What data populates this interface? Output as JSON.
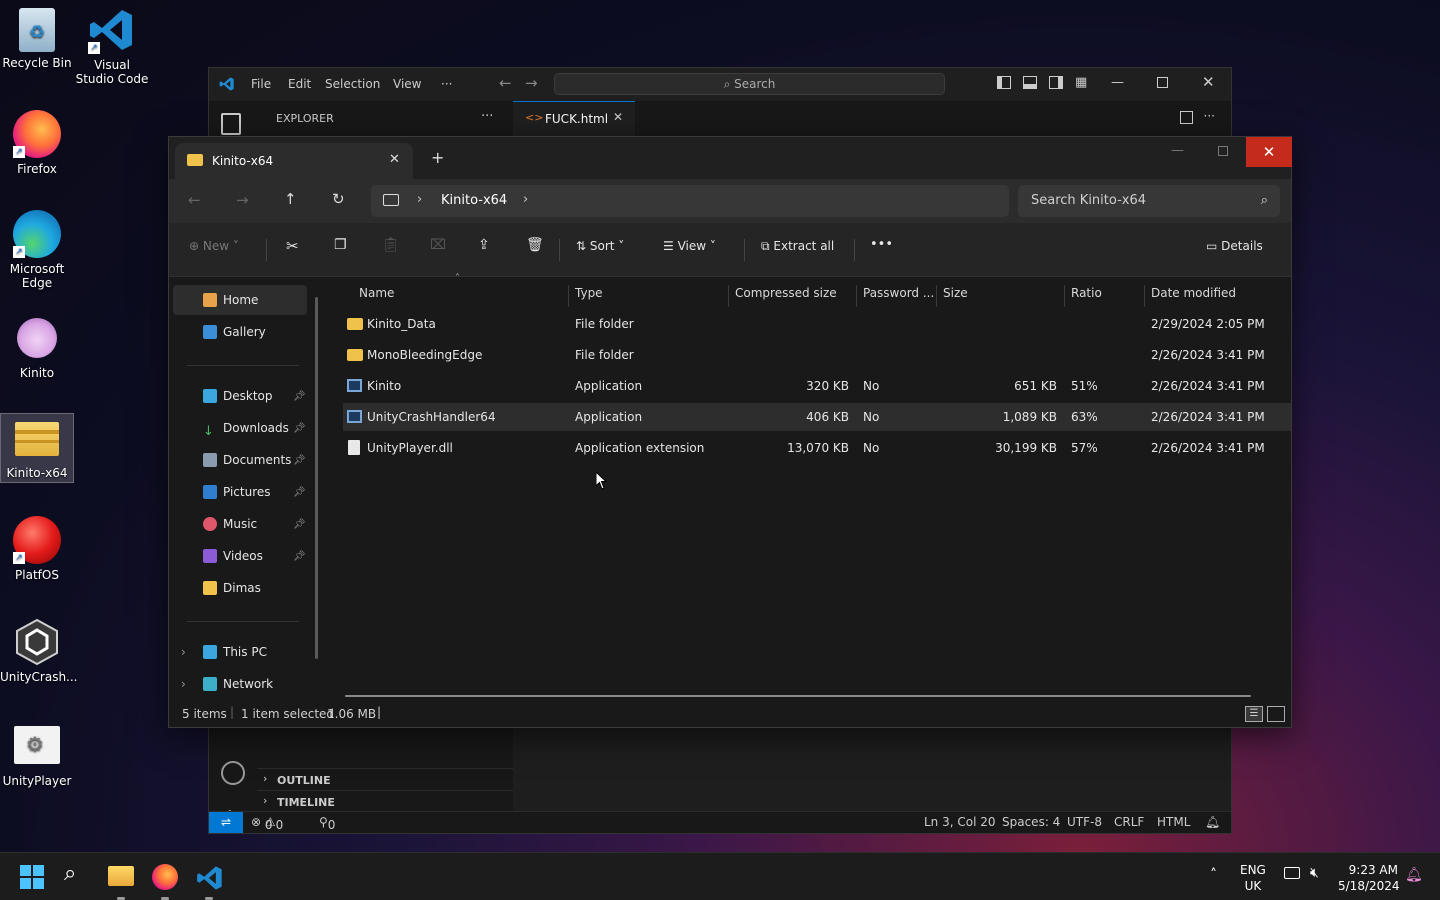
{
  "desktop": {
    "icons": [
      {
        "label": "Recycle Bin"
      },
      {
        "label": "Visual Studio Code"
      },
      {
        "label": "Firefox"
      },
      {
        "label": "Microsoft Edge"
      },
      {
        "label": "Kinito"
      },
      {
        "label": "Kinito-x64"
      },
      {
        "label": "PlatfOS"
      },
      {
        "label": "UnityCrash..."
      },
      {
        "label": "UnityPlayer"
      }
    ]
  },
  "vscode": {
    "menu": {
      "file": "File",
      "edit": "Edit",
      "selection": "Selection",
      "view": "View",
      "more": "···"
    },
    "search_label": "Search",
    "explorer_title": "EXPLORER",
    "tab_name": "FUCK.html",
    "outline": "OUTLINE",
    "timeline": "TIMELINE",
    "status": {
      "errors": "0",
      "warnings": "0",
      "ports": "0",
      "position": "Ln 3, Col 20",
      "spaces": "Spaces: 4",
      "encoding": "UTF-8",
      "eol": "CRLF",
      "language": "HTML"
    }
  },
  "explorer": {
    "tab_title": "Kinito-x64",
    "breadcrumb": "Kinito-x64",
    "search_placeholder": "Search Kinito-x64",
    "toolbar": {
      "new": "New",
      "sort": "Sort",
      "view": "View",
      "extract_all": "Extract all",
      "more": "•••",
      "details": "Details"
    },
    "nav": {
      "home": "Home",
      "gallery": "Gallery",
      "desktop": "Desktop",
      "downloads": "Downloads",
      "documents": "Documents",
      "pictures": "Pictures",
      "music": "Music",
      "videos": "Videos",
      "dimas": "Dimas",
      "this_pc": "This PC",
      "network": "Network"
    },
    "columns": {
      "name": "Name",
      "type": "Type",
      "compressed": "Compressed size",
      "password": "Password ...",
      "size": "Size",
      "ratio": "Ratio",
      "date": "Date modified"
    },
    "rows": [
      {
        "name": "Kinito_Data",
        "type": "File folder",
        "compressed": "",
        "password": "",
        "size": "",
        "ratio": "",
        "date": "2/29/2024 2:05 PM"
      },
      {
        "name": "MonoBleedingEdge",
        "type": "File folder",
        "compressed": "",
        "password": "",
        "size": "",
        "ratio": "",
        "date": "2/26/2024 3:41 PM"
      },
      {
        "name": "Kinito",
        "type": "Application",
        "compressed": "320 KB",
        "password": "No",
        "size": "651 KB",
        "ratio": "51%",
        "date": "2/26/2024 3:41 PM"
      },
      {
        "name": "UnityCrashHandler64",
        "type": "Application",
        "compressed": "406 KB",
        "password": "No",
        "size": "1,089 KB",
        "ratio": "63%",
        "date": "2/26/2024 3:41 PM"
      },
      {
        "name": "UnityPlayer.dll",
        "type": "Application extension",
        "compressed": "13,070 KB",
        "password": "No",
        "size": "30,199 KB",
        "ratio": "57%",
        "date": "2/26/2024 3:41 PM"
      }
    ],
    "status": {
      "items": "5 items",
      "selected": "1 item selected",
      "size": "1.06 MB"
    }
  },
  "taskbar": {
    "lang1": "ENG",
    "lang2": "UK",
    "time": "9:23 AM",
    "date": "5/18/2024"
  },
  "colors": {
    "accent": "#0078d4",
    "close_red": "#c42b1c",
    "folder": "#f0c24a"
  }
}
